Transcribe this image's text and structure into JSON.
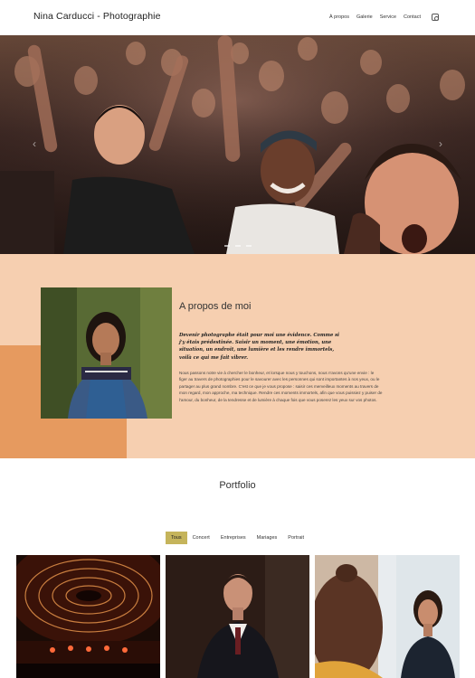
{
  "header": {
    "brand": "Nina Carducci - Photographie",
    "nav": [
      {
        "label": "À propos"
      },
      {
        "label": "Galerie"
      },
      {
        "label": "Service"
      },
      {
        "label": "Contact"
      }
    ],
    "social_icon": "instagram-icon"
  },
  "hero": {
    "image": "concert crowd cheering"
  },
  "about": {
    "title": "A propos de moi",
    "lead": "Devenir photographe était pour moi une évidence. Comme si j'y étais prédestinée. Saisir un moment, une émotion, une situation, un endroit, une lumière et les rendre immortels, voilà ce qui me fait vibrer.",
    "body": "Nous passons notre vie à chercher le bonheur, et lorsque nous y touchons, nous n'avons qu'une envie : le figer au travers de photographies pour le savourer avec les personnes qui sont importantes à nos yeux, ou le partager au plus grand nombre. C'est ce que je vous propose : saisir ces merveilleux moments au travers de mon regard, mon approche, ma technique. Rendre ces moments immortels, afin que vous puissiez y puiser de l'amour, du bonheur, de la tendresse et de lumière à chaque fois que vous poserez les yeux sur vos photos.",
    "photo": "portrait of woman in denim overalls"
  },
  "portfolio": {
    "title": "Portfolio",
    "filters": [
      {
        "label": "Tous",
        "active": true
      },
      {
        "label": "Concert",
        "active": false
      },
      {
        "label": "Entreprises",
        "active": false
      },
      {
        "label": "Mariages",
        "active": false
      },
      {
        "label": "Portrait",
        "active": false
      }
    ],
    "thumbnails": [
      "concert hall stage lights",
      "businessman in suit",
      "woman smiling at office"
    ]
  },
  "colors": {
    "accent": "#c5b45b",
    "about_bg": "#f6cfb0",
    "about_accent": "#e69a5f"
  }
}
